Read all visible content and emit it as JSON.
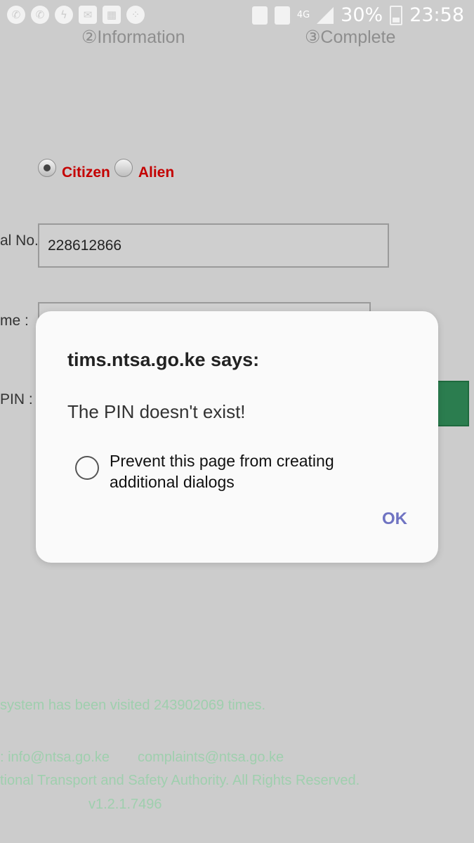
{
  "status_bar": {
    "icons_left": [
      "whatsapp-icon",
      "whatsapp-icon",
      "messenger-icon",
      "email-icon",
      "gallery-icon",
      "apps-icon"
    ],
    "battery": "30%",
    "time": "23:58",
    "network": "4G"
  },
  "page": {
    "steps": {
      "step2": "②Information",
      "step3": "③Complete"
    },
    "radio_citizen": "Citizen",
    "radio_alien": "Alien",
    "label_serial": "al No.:",
    "serial_value": "228612866",
    "label_name": "me :",
    "label_pin": "PIN :",
    "footer_visits": "system has been visited 243902069 times.",
    "footer_contact_prefix": ": info@ntsa.go.ke",
    "footer_contact_complaints": "complaints@ntsa.go.ke",
    "footer_copyright": "tional Transport and Safety Authority. All Rights Reserved.",
    "footer_version": "v1.2.1.7496"
  },
  "dialog": {
    "title": "tims.ntsa.go.ke says:",
    "message": "The PIN doesn't exist!",
    "checkbox_label": "Prevent this page from creating additional dialogs",
    "ok_label": "OK"
  },
  "colors": {
    "overlay": "#cccccc",
    "radio_label": "#c40000",
    "ok_text": "#6f73c2",
    "footer_text": "#9fcfae",
    "button_green": "#2b7d4f"
  }
}
